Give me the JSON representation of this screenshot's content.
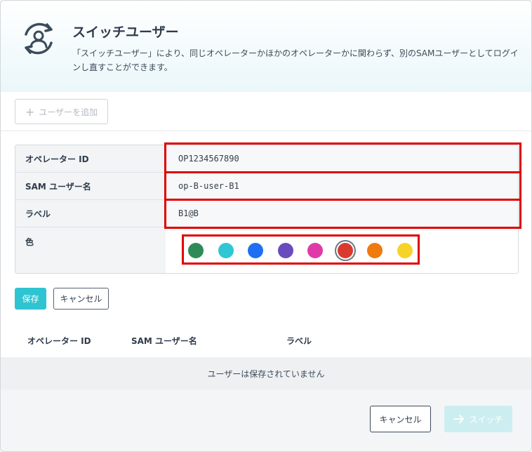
{
  "header": {
    "title": "スイッチユーザー",
    "description": "「スイッチユーザー」により、同じオペレーターかほかのオペレーターかに関わらず、別のSAMユーザーとしてログインし直すことができます。",
    "icon": "switch-user-icon"
  },
  "toolbar": {
    "add_user_label": "ユーザーを追加",
    "add_icon": "plus-icon"
  },
  "form": {
    "operator_id_label": "オペレーター ID",
    "operator_id_value": "OP1234567890",
    "sam_user_label": "SAM ユーザー名",
    "sam_user_value": "op-B-user-B1",
    "label_label": "ラベル",
    "label_value": "B1@B",
    "color_label": "色",
    "colors": [
      "#2e8b57",
      "#2ec7d3",
      "#1f6ff2",
      "#6a4bbd",
      "#e03aa8",
      "#d83a2f",
      "#ef7a0e",
      "#f5d32a"
    ],
    "selected_color_index": 5
  },
  "actions": {
    "save_label": "保存",
    "cancel_label": "キャンセル"
  },
  "table": {
    "headers": [
      "オペレーター ID",
      "SAM ユーザー名",
      "ラベル"
    ],
    "empty_message": "ユーザーは保存されていません"
  },
  "footer": {
    "cancel_label": "キャンセル",
    "switch_label": "スイッチ",
    "switch_icon": "arrow-right-icon"
  },
  "theme": {
    "accent": "#2ec4d1",
    "highlight": "#e00000"
  }
}
